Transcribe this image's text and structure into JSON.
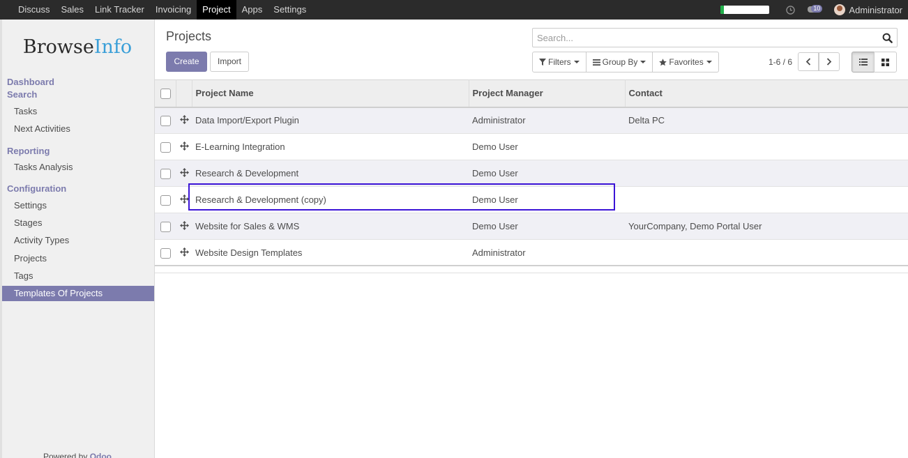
{
  "topbar": {
    "menu": [
      "Discuss",
      "Sales",
      "Link Tracker",
      "Invoicing",
      "Project",
      "Apps",
      "Settings"
    ],
    "active_menu": "Project",
    "message_count": "10",
    "user_name": "Administrator",
    "loading_progress": 0.07
  },
  "sidebar": {
    "logo_part1": "Browse",
    "logo_part2": "Info",
    "sections": {
      "dashboard": "Dashboard",
      "search": "Search",
      "reporting": "Reporting",
      "configuration": "Configuration"
    },
    "items": {
      "tasks": "Tasks",
      "next_activities": "Next Activities",
      "tasks_analysis": "Tasks Analysis",
      "settings": "Settings",
      "stages": "Stages",
      "activity_types": "Activity Types",
      "projects": "Projects",
      "tags": "Tags",
      "templates_of_projects": "Templates Of Projects"
    },
    "active_item": "Templates Of Projects",
    "powered_by": "Powered by",
    "powered_brand": "Odoo"
  },
  "control_panel": {
    "title": "Projects",
    "create_label": "Create",
    "import_label": "Import",
    "search_placeholder": "Search...",
    "filters_label": "Filters",
    "group_by_label": "Group By",
    "favorites_label": "Favorites",
    "pager": "1-6 / 6"
  },
  "table": {
    "columns": [
      "Project Name",
      "Project Manager",
      "Contact"
    ],
    "rows": [
      {
        "name": "Data Import/Export Plugin",
        "manager": "Administrator",
        "contact": "Delta PC"
      },
      {
        "name": "E-Learning Integration",
        "manager": "Demo User",
        "contact": ""
      },
      {
        "name": "Research & Development",
        "manager": "Demo User",
        "contact": ""
      },
      {
        "name": "Research & Development (copy)",
        "manager": "Demo User",
        "contact": ""
      },
      {
        "name": "Website for Sales & WMS",
        "manager": "Demo User",
        "contact": "YourCompany, Demo Portal User"
      },
      {
        "name": "Website Design Templates",
        "manager": "Administrator",
        "contact": ""
      }
    ]
  },
  "colors": {
    "accent": "#7c7bad",
    "topbar": "#2b2b2b",
    "highlight_box": "#3b14d6"
  }
}
